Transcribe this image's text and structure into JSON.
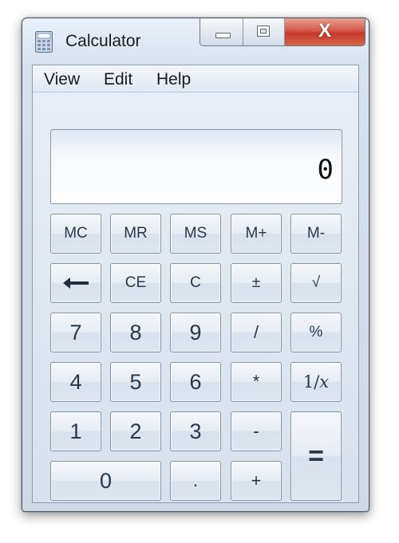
{
  "window": {
    "title": "Calculator",
    "icon": "calculator-icon"
  },
  "caption_buttons": {
    "close_label": "X"
  },
  "menu": {
    "view": "View",
    "edit": "Edit",
    "help": "Help"
  },
  "display": {
    "value": "0"
  },
  "keys": {
    "mc": "MC",
    "mr": "MR",
    "ms": "MS",
    "mplus": "M+",
    "mminus": "M-",
    "backspace_icon": "backspace-arrow-icon",
    "ce": "CE",
    "c": "C",
    "plusminus": "±",
    "sqrt": "√",
    "n7": "7",
    "n8": "8",
    "n9": "9",
    "divide": "/",
    "percent": "%",
    "n4": "4",
    "n5": "5",
    "n6": "6",
    "multiply": "*",
    "reciprocal_prefix": "1/",
    "reciprocal_var": "x",
    "n1": "1",
    "n2": "2",
    "n3": "3",
    "minus": "-",
    "n0": "0",
    "decimal": ".",
    "plus": "+",
    "equals": "="
  },
  "colors": {
    "button_text": "#26384c",
    "close_button": "#c4382a",
    "window_frame": "#cdd9e7"
  }
}
